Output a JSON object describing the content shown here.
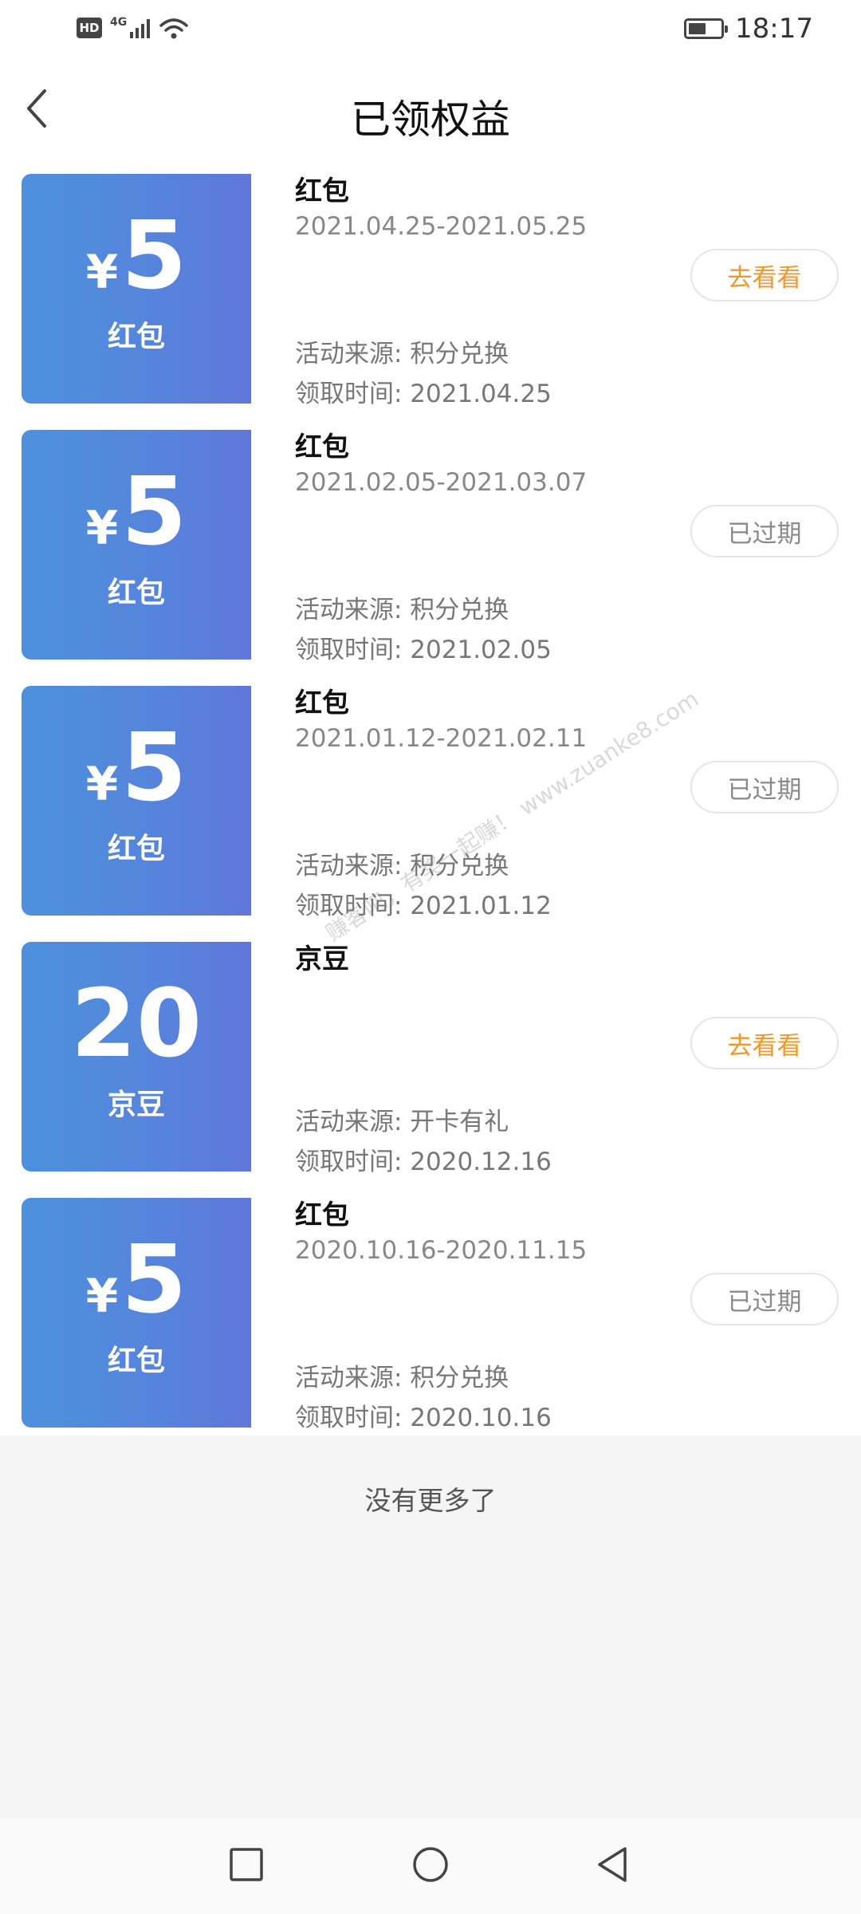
{
  "status_bar": {
    "hd_label": "HD",
    "network_label": "4G",
    "time": "18:17",
    "battery_level": 0.55
  },
  "header": {
    "title": "已领权益"
  },
  "items": [
    {
      "amount_prefix": "¥",
      "amount": "5",
      "coupon_type": "红包",
      "title": "红包",
      "period": "2021.04.25-2021.05.25",
      "source": "活动来源: 积分兑换",
      "received": "领取时间: 2021.04.25",
      "button_label": "去看看",
      "button_state": "go"
    },
    {
      "amount_prefix": "¥",
      "amount": "5",
      "coupon_type": "红包",
      "title": "红包",
      "period": "2021.02.05-2021.03.07",
      "source": "活动来源: 积分兑换",
      "received": "领取时间: 2021.02.05",
      "button_label": "已过期",
      "button_state": "expired"
    },
    {
      "amount_prefix": "¥",
      "amount": "5",
      "coupon_type": "红包",
      "title": "红包",
      "period": "2021.01.12-2021.02.11",
      "source": "活动来源: 积分兑换",
      "received": "领取时间: 2021.01.12",
      "button_label": "已过期",
      "button_state": "expired"
    },
    {
      "amount_prefix": "",
      "amount": "20",
      "coupon_type": "京豆",
      "title": "京豆",
      "period": "",
      "source": "活动来源: 开卡有礼",
      "received": "领取时间: 2020.12.16",
      "button_label": "去看看",
      "button_state": "go"
    },
    {
      "amount_prefix": "¥",
      "amount": "5",
      "coupon_type": "红包",
      "title": "红包",
      "period": "2020.10.16-2020.11.15",
      "source": "活动来源: 积分兑换",
      "received": "领取时间: 2020.10.16",
      "button_label": "已过期",
      "button_state": "expired"
    }
  ],
  "footer": {
    "no_more": "没有更多了"
  },
  "watermark": "赚客吧，有奖一起赚！ www.zuanke8.com",
  "colors": {
    "coupon_start": "#4d91dd",
    "coupon_end": "#6077d9",
    "go_button_text": "#f0982a",
    "expired_button_text": "#8a8a8a"
  }
}
